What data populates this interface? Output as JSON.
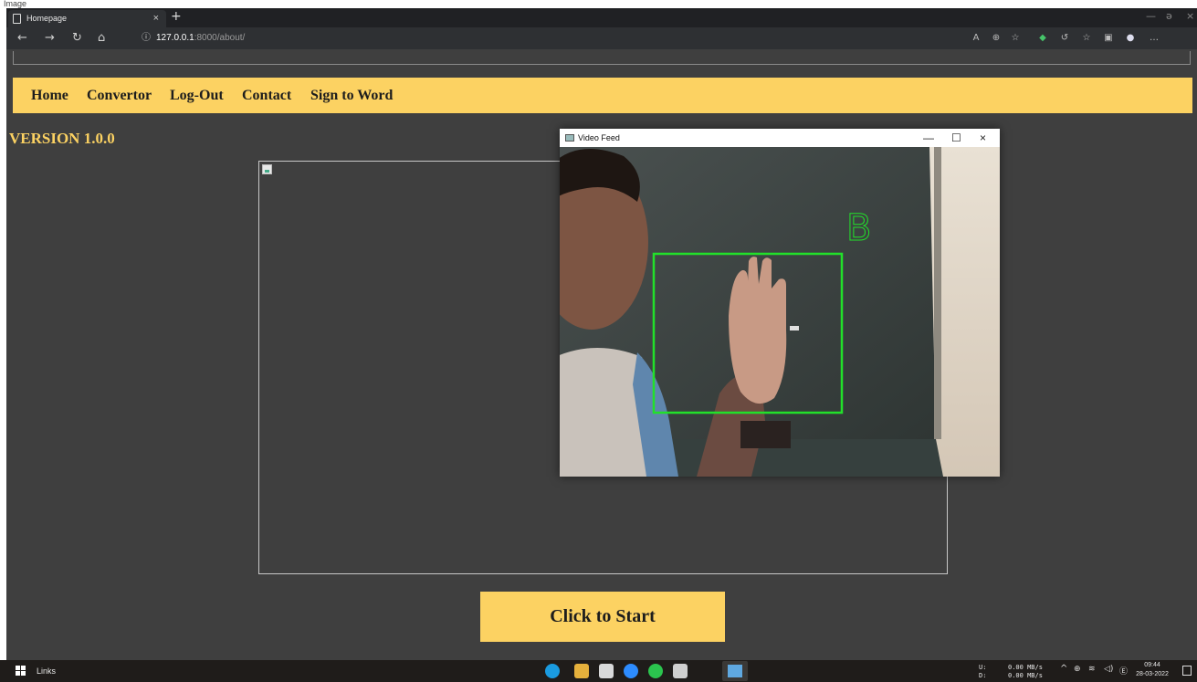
{
  "caption": "Image",
  "browser": {
    "tab_title": "Homepage",
    "tab_close": "×",
    "new_tab": "+",
    "url_host": "127.0.0.1",
    "url_path": ":8000/about/",
    "info_icon": "ⓘ",
    "window_controls": [
      "—",
      "ə",
      "×"
    ]
  },
  "nav": {
    "items": [
      "Home",
      "Convertor",
      "Log-Out",
      "Contact",
      "Sign to Word"
    ]
  },
  "page": {
    "version": "VERSION 1.0.0",
    "start_button": "Click to Start"
  },
  "video_window": {
    "title": "Video Feed",
    "minimize": "—",
    "maximize": "☐",
    "close": "×",
    "detected_letter": "B"
  },
  "taskbar": {
    "start_label": "Links",
    "net_upload_label": "U:",
    "net_upload_value": "0.00 MB/s",
    "net_download_label": "D:",
    "net_download_value": "0.00 MB/s",
    "time": "09:44",
    "date": "28-03-2022"
  },
  "colors": {
    "accent": "#fcd262",
    "page_bg": "#3f3f3f",
    "detection_box": "#22e02a"
  }
}
